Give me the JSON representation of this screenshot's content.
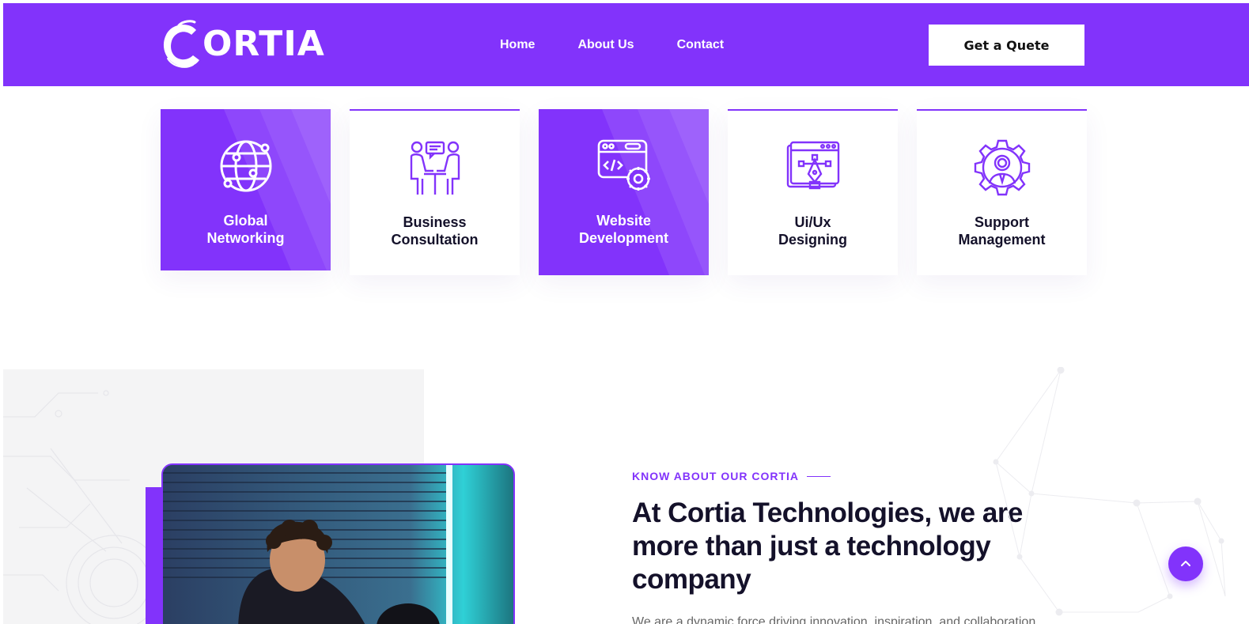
{
  "header": {
    "logo_text": "ORTIA",
    "nav": [
      "Home",
      "About Us",
      "Contact"
    ],
    "cta_label": "Get a Quete"
  },
  "services": [
    {
      "label": "Global\nNetworking",
      "icon": "globe-network-icon",
      "active": true
    },
    {
      "label": "Business\nConsultation",
      "icon": "consultation-icon",
      "active": false
    },
    {
      "label": "Website\nDevelopment",
      "icon": "web-code-gear-icon",
      "active": true
    },
    {
      "label": "Ui/Ux\nDesigning",
      "icon": "pen-tool-design-icon",
      "active": false
    },
    {
      "label": "Support\nManagement",
      "icon": "support-gear-person-icon",
      "active": false
    }
  ],
  "about": {
    "eyebrow": "KNOW ABOUT OUR CORTIA",
    "title": "At Cortia Technologies, we are more than just a technology company",
    "body_peek": "We are a dynamic force driving innovation, inspiration, and collaboration"
  },
  "colors": {
    "brand_purple": "#8233fb",
    "dark_text": "#14112a"
  }
}
